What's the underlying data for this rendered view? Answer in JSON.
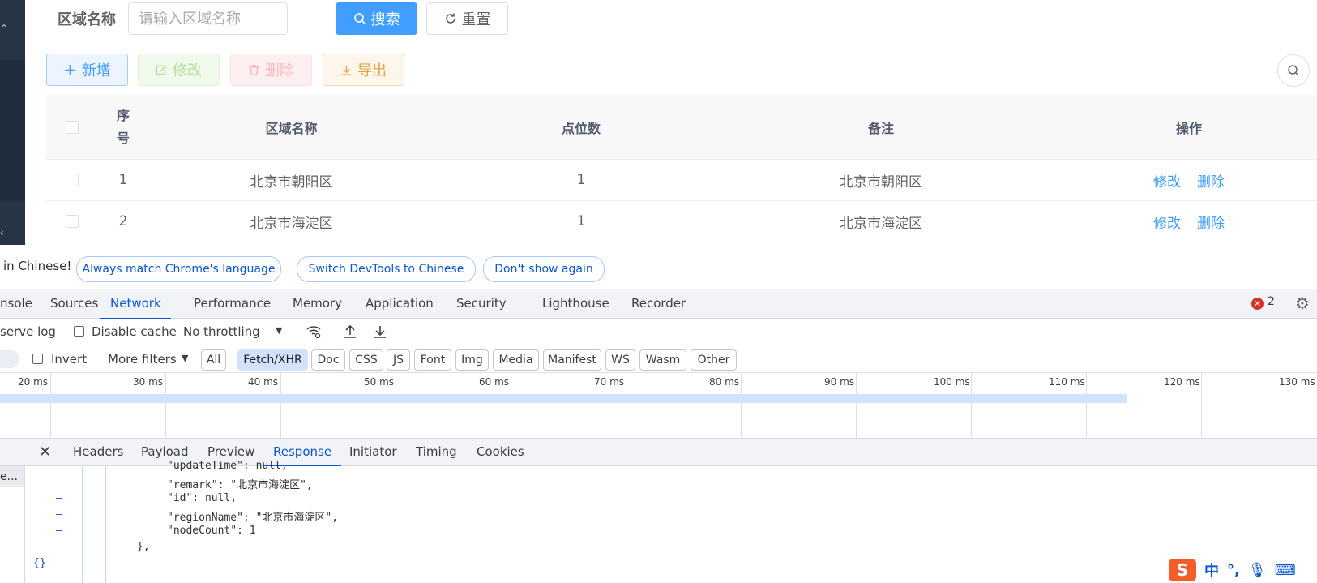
{
  "app": {
    "search": {
      "label": "区域名称",
      "placeholder": "请输入区域名称",
      "search_button": "搜索",
      "reset_button": "重置"
    },
    "toolbar": {
      "add": "新增",
      "edit": "修改",
      "delete": "删除",
      "export": "导出"
    },
    "table": {
      "headers": {
        "index": "序\n号",
        "name": "区域名称",
        "count": "点位数",
        "remark": "备注",
        "actions": "操作"
      },
      "rows": [
        {
          "index": "1",
          "name": "北京市朝阳区",
          "count": "1",
          "remark": "北京市朝阳区",
          "edit": "修改",
          "delete": "删除"
        },
        {
          "index": "2",
          "name": "北京市海淀区",
          "count": "1",
          "remark": "北京市海淀区",
          "edit": "修改",
          "delete": "删除"
        }
      ]
    }
  },
  "devtools": {
    "infobar": {
      "message": "in Chinese!",
      "btn_match": "Always match Chrome's language",
      "btn_switch": "Switch DevTools to Chinese",
      "btn_dont": "Don't show again"
    },
    "tabs": [
      "nsole",
      "Sources",
      "Network",
      "Performance",
      "Memory",
      "Application",
      "Security",
      "Lighthouse",
      "Recorder"
    ],
    "active_tab": "Network",
    "error_count": "2",
    "toolbar1": {
      "preserve_log": "serve log",
      "disable_cache": "Disable cache",
      "throttling": "No throttling"
    },
    "toolbar2": {
      "invert": "Invert",
      "more_filters": "More filters",
      "filters": [
        "All",
        "Fetch/XHR",
        "Doc",
        "CSS",
        "JS",
        "Font",
        "Img",
        "Media",
        "Manifest",
        "WS",
        "Wasm",
        "Other"
      ],
      "selected_filter": "Fetch/XHR"
    },
    "timeline_ticks": [
      "20 ms",
      "30 ms",
      "40 ms",
      "50 ms",
      "60 ms",
      "70 ms",
      "80 ms",
      "90 ms",
      "100 ms",
      "110 ms",
      "120 ms",
      "130 ms"
    ],
    "detail_tabs": [
      "Headers",
      "Payload",
      "Preview",
      "Response",
      "Initiator",
      "Timing",
      "Cookies"
    ],
    "active_detail_tab": "Response",
    "left_item": "e...",
    "response_lines": [
      "\"updateTime\": null,",
      "\"remark\": \"北京市海淀区\",",
      "\"id\": null,",
      "\"regionName\": \"北京市海淀区\",",
      "\"nodeCount\": 1",
      "},",
      "{}"
    ]
  },
  "ime": {
    "lang": "中",
    "punct": "°,"
  },
  "colors": {
    "primary": "#409eff",
    "devtools_accent": "#0b57d0",
    "error": "#d93025"
  }
}
